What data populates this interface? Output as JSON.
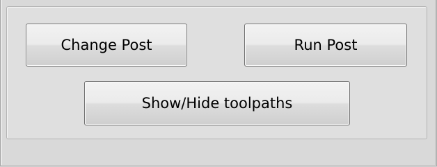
{
  "post_panel": {
    "change_post_label": "Change Post",
    "run_post_label": "Run Post",
    "show_hide_label": "Show/Hide toolpaths"
  }
}
